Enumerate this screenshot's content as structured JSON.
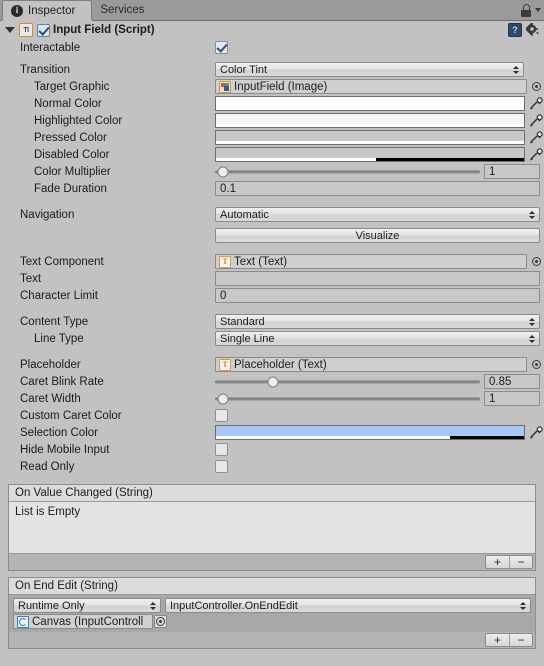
{
  "window": {
    "tabs": [
      {
        "label": "Inspector",
        "icon": "inspector-info-icon",
        "active": true
      },
      {
        "label": "Services",
        "icon": "",
        "active": false
      }
    ],
    "lock_icon": "lock-icon",
    "menu_icon": "chevron-down-icon"
  },
  "component": {
    "title": "Input Field (Script)",
    "script_icon_text": "TI",
    "enabled": true,
    "help_icon": "help-book-icon",
    "settings_icon": "gear-icon"
  },
  "properties": {
    "interactable": {
      "label": "Interactable",
      "checked": true
    },
    "transition": {
      "label": "Transition",
      "value": "Color Tint"
    },
    "target_graphic": {
      "label": "Target Graphic",
      "value": "InputField (Image)",
      "icon": "image-icon"
    },
    "normal_color": {
      "label": "Normal Color",
      "color": "#FFFFFF",
      "alpha": 100
    },
    "highlighted_color": {
      "label": "Highlighted Color",
      "color": "#F5F5F5",
      "alpha": 100
    },
    "pressed_color": {
      "label": "Pressed Color",
      "color": "#C8C8C8",
      "alpha": 100
    },
    "disabled_color": {
      "label": "Disabled Color",
      "color": "#C8C8C8",
      "alpha": 50
    },
    "color_multiplier": {
      "label": "Color Multiplier",
      "value": "1",
      "slider_pct": 0
    },
    "fade_duration": {
      "label": "Fade Duration",
      "value": "0.1"
    },
    "navigation": {
      "label": "Navigation",
      "value": "Automatic"
    },
    "visualize": {
      "label": "Visualize"
    },
    "text_component": {
      "label": "Text Component",
      "value": "Text (Text)",
      "icon": "text-icon"
    },
    "text": {
      "label": "Text",
      "value": ""
    },
    "character_limit": {
      "label": "Character Limit",
      "value": "0"
    },
    "content_type": {
      "label": "Content Type",
      "value": "Standard"
    },
    "line_type": {
      "label": "Line Type",
      "value": "Single Line"
    },
    "placeholder": {
      "label": "Placeholder",
      "value": "Placeholder (Text)",
      "icon": "text-icon"
    },
    "caret_blink_rate": {
      "label": "Caret Blink Rate",
      "value": "0.85",
      "slider_pct": 22
    },
    "caret_width": {
      "label": "Caret Width",
      "value": "1",
      "slider_pct": 0
    },
    "custom_caret_color": {
      "label": "Custom Caret Color",
      "checked": false
    },
    "selection_color": {
      "label": "Selection Color",
      "color": "#A8C8F7",
      "alpha": 75
    },
    "hide_mobile_input": {
      "label": "Hide Mobile Input",
      "checked": false
    },
    "read_only": {
      "label": "Read Only",
      "checked": false
    }
  },
  "events": {
    "on_value_changed": {
      "title": "On Value Changed (String)",
      "empty_text": "List is Empty",
      "add_label": "+",
      "remove_label": "−"
    },
    "on_end_edit": {
      "title": "On End Edit (String)",
      "rows": [
        {
          "call_state": "Runtime Only",
          "function": "InputController.OnEndEdit",
          "object": "Canvas (InputControll",
          "object_icon": "canvas-icon"
        }
      ],
      "add_label": "+",
      "remove_label": "−"
    }
  }
}
